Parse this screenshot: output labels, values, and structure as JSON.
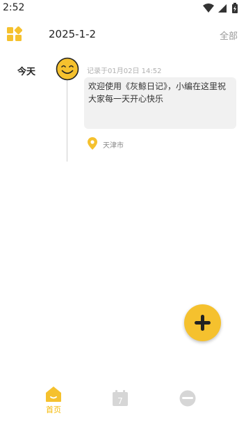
{
  "status_bar": {
    "time": "2:52"
  },
  "header": {
    "date": "2025-1-2",
    "filter_label": "全部"
  },
  "timeline": {
    "day_label": "今天",
    "entries": [
      {
        "record_time": "记录于01月02日 14:52",
        "text": "欢迎使用《灰鲸日记》，小编在这里祝大家每一天开心快乐",
        "location": "天津市",
        "mood": "smile-icon"
      }
    ]
  },
  "nav": {
    "home_label": "首页",
    "calendar_day": "7"
  },
  "colors": {
    "accent": "#f5c12e",
    "inactive_icon": "#d6d6d6",
    "card_bg": "#f1f1f1"
  }
}
